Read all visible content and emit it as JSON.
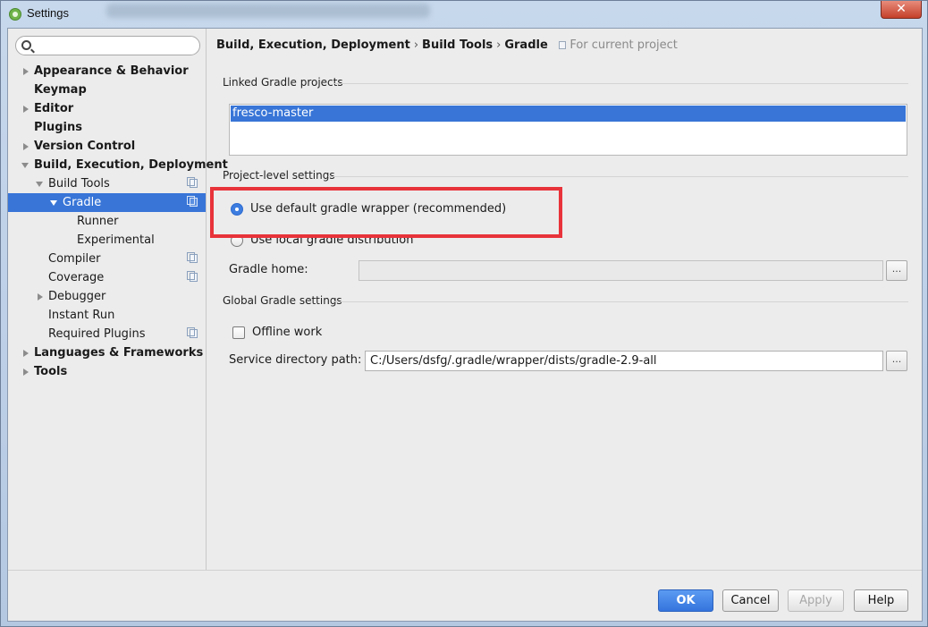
{
  "window": {
    "title": "Settings",
    "close_glyph": "✕"
  },
  "search": {
    "value": "",
    "placeholder": ""
  },
  "sidebar": {
    "items": [
      {
        "label": "Appearance & Behavior"
      },
      {
        "label": "Keymap"
      },
      {
        "label": "Editor"
      },
      {
        "label": "Plugins"
      },
      {
        "label": "Version Control"
      },
      {
        "label": "Build, Execution, Deployment"
      },
      {
        "label": "Build Tools"
      },
      {
        "label": "Gradle"
      },
      {
        "label": "Runner"
      },
      {
        "label": "Experimental"
      },
      {
        "label": "Compiler"
      },
      {
        "label": "Coverage"
      },
      {
        "label": "Debugger"
      },
      {
        "label": "Instant Run"
      },
      {
        "label": "Required Plugins"
      },
      {
        "label": "Languages & Frameworks"
      },
      {
        "label": "Tools"
      }
    ]
  },
  "breadcrumb": {
    "items": [
      "Build, Execution, Deployment",
      "Build Tools",
      "Gradle"
    ],
    "separator": "›",
    "note": "For current project"
  },
  "linked_projects": {
    "title": "Linked Gradle projects",
    "items": [
      "fresco-master"
    ]
  },
  "project_settings": {
    "title": "Project-level settings",
    "option_default_wrapper": "Use default gradle wrapper (recommended)",
    "option_local_distribution": "Use local gradle distribution",
    "gradle_home_label": "Gradle home:",
    "gradle_home_value": "",
    "browse_label": "..."
  },
  "global_settings": {
    "title": "Global Gradle settings",
    "offline_work_label": "Offline work",
    "service_dir_label": "Service directory path:",
    "service_dir_value": "C:/Users/dsfg/.gradle/wrapper/dists/gradle-2.9-all",
    "browse_label": "..."
  },
  "buttons": {
    "ok": "OK",
    "cancel": "Cancel",
    "apply": "Apply",
    "help": "Help"
  },
  "colors": {
    "selection": "#3875d7",
    "highlight_border": "#e8333a",
    "primary_button": "#3474dd"
  }
}
